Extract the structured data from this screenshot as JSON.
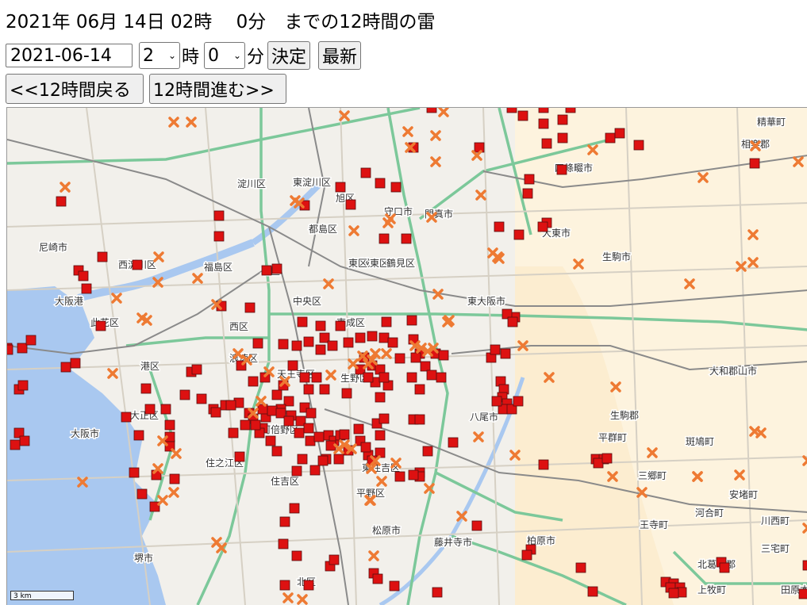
{
  "header": {
    "title": "2021年 06月 14日 02時　 0分　までの12時間の雷"
  },
  "controls": {
    "date_value": "2021-06-14",
    "hour_value": "2",
    "hour_unit": "時",
    "minute_value": "0",
    "minute_unit": "分",
    "decide_label": "決定",
    "latest_label": "最新",
    "back_label": "<<12時間戻る",
    "forward_label": "12時間進む>>"
  },
  "map": {
    "scale_label": "3 km",
    "colors": {
      "land": "#f2f0eb",
      "water": "#a9c8f0",
      "mountain": "#fdf3de",
      "expressway": "#7cc89a",
      "road": "#cfcfcf",
      "rail": "#888888",
      "strike_marker": "#dd1111",
      "cross_marker": "#ee7a33"
    },
    "labels": [
      {
        "text": "淀川区"
      },
      {
        "text": "東淀川区"
      },
      {
        "text": "旭区"
      },
      {
        "text": "守口市"
      },
      {
        "text": "門真市"
      },
      {
        "text": "四條畷市"
      },
      {
        "text": "精華町"
      },
      {
        "text": "相楽郡"
      },
      {
        "text": "尼崎市"
      },
      {
        "text": "西淀川区"
      },
      {
        "text": "福島区"
      },
      {
        "text": "北区"
      },
      {
        "text": "都島区"
      },
      {
        "text": "城東区"
      },
      {
        "text": "鶴見区"
      },
      {
        "text": "大東市"
      },
      {
        "text": "生駒市"
      },
      {
        "text": "大阪港"
      },
      {
        "text": "此花区"
      },
      {
        "text": "西区"
      },
      {
        "text": "中央区"
      },
      {
        "text": "東成区"
      },
      {
        "text": "東大阪市"
      },
      {
        "text": "港区"
      },
      {
        "text": "浪速区"
      },
      {
        "text": "天王寺区"
      },
      {
        "text": "生野区"
      },
      {
        "text": "大和郡山市"
      },
      {
        "text": "大正区"
      },
      {
        "text": "大阪市"
      },
      {
        "text": "阿倍野区"
      },
      {
        "text": "八尾市"
      },
      {
        "text": "生駒郡"
      },
      {
        "text": "平群町"
      },
      {
        "text": "斑鳩町"
      },
      {
        "text": "住之江区"
      },
      {
        "text": "住吉区"
      },
      {
        "text": "東住吉区"
      },
      {
        "text": "平野区"
      },
      {
        "text": "三郷町"
      },
      {
        "text": "安堵町"
      },
      {
        "text": "王寺町"
      },
      {
        "text": "河合町"
      },
      {
        "text": "柏原市"
      },
      {
        "text": "藤井寺市"
      },
      {
        "text": "松原市"
      },
      {
        "text": "堺市"
      },
      {
        "text": "北区"
      },
      {
        "text": "北葛城郡"
      },
      {
        "text": "三宅町"
      },
      {
        "text": "上牧町"
      },
      {
        "text": "田原本"
      },
      {
        "text": "川西町"
      },
      {
        "text": "東区"
      }
    ]
  }
}
